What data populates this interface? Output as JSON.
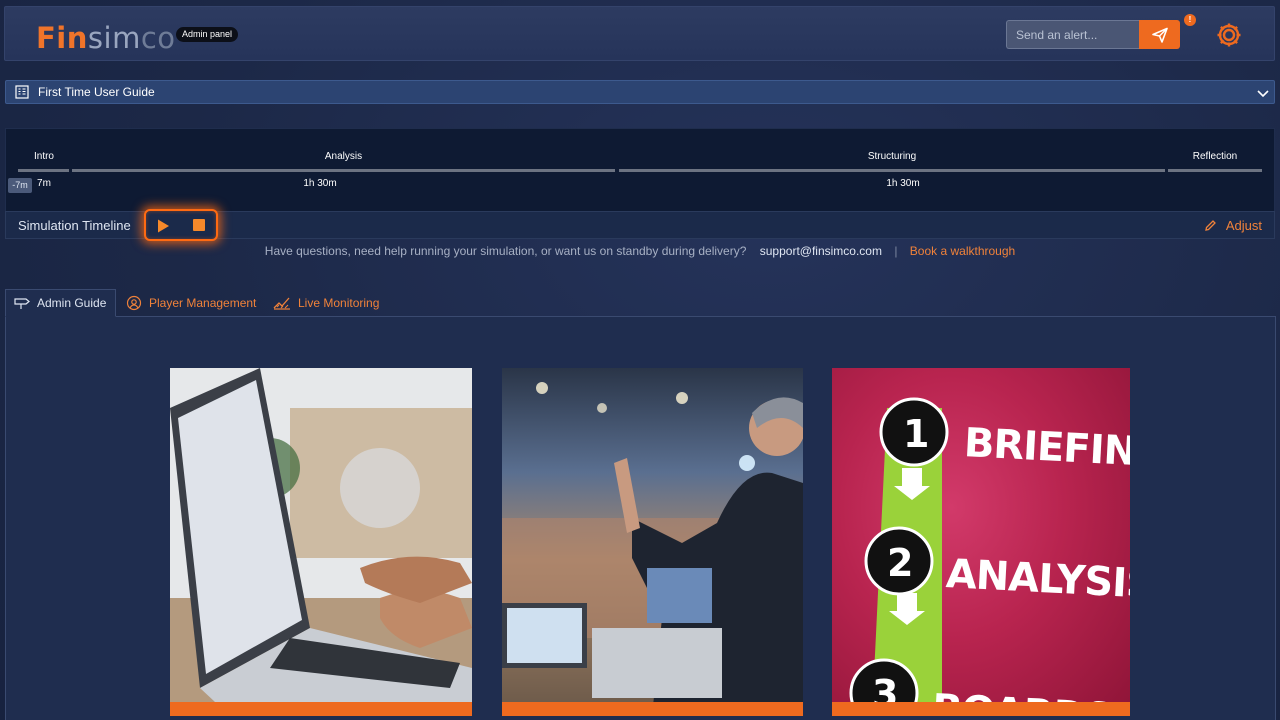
{
  "header": {
    "logo_fin": "Fin",
    "logo_sim": "sim",
    "logo_co": "co",
    "admin_badge": "Admin panel",
    "alert_placeholder": "Send an alert...",
    "notif_badge": "!"
  },
  "guide": {
    "title": "First Time User Guide"
  },
  "timeline": {
    "phases": [
      {
        "name": "Intro",
        "duration": "7m"
      },
      {
        "name": "Analysis",
        "duration": "1h 30m"
      },
      {
        "name": "Structuring",
        "duration": "1h 30m"
      },
      {
        "name": "Reflection",
        "duration": ""
      }
    ],
    "offset": "-7m",
    "label": "Simulation Timeline",
    "adjust_label": "Adjust"
  },
  "help": {
    "question": "Have questions, need help running your simulation, or want us on standby during delivery?",
    "email": "support@finsimco.com",
    "separator": "|",
    "book": "Book a walkthrough"
  },
  "tabs": [
    {
      "label": "Admin Guide",
      "icon": "signpost-icon",
      "active": true
    },
    {
      "label": "Player Management",
      "icon": "user-gear-icon",
      "active": false
    },
    {
      "label": "Live Monitoring",
      "icon": "monitoring-icon",
      "active": false
    }
  ],
  "cards": [
    {
      "image": "laptop-typing"
    },
    {
      "image": "presenter-conference"
    },
    {
      "image": "steps-graphic",
      "steps": [
        "1",
        "2",
        "3"
      ],
      "step_labels": [
        "BRIEFING",
        "ANALYSIS",
        "BOARDS"
      ]
    }
  ],
  "colors": {
    "accent": "#ee6a1f",
    "background": "#1d2a4d",
    "guide_bar": "#2c4472"
  }
}
